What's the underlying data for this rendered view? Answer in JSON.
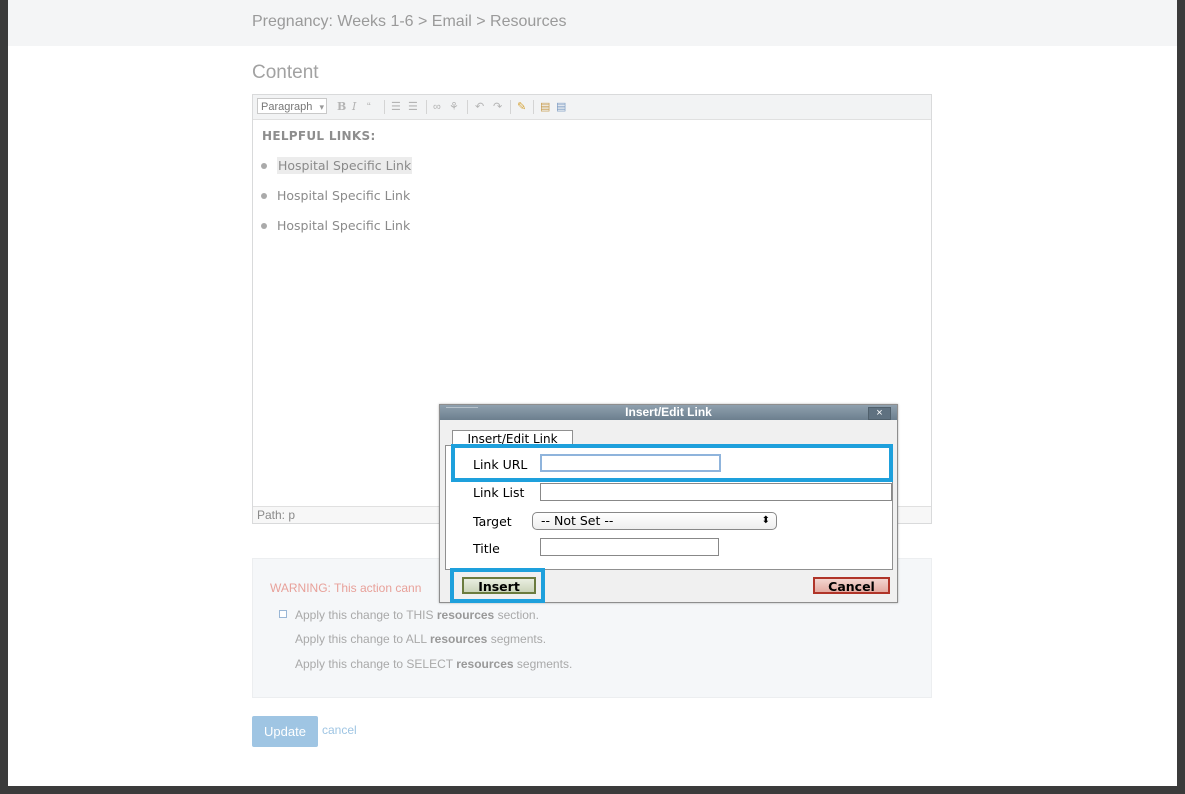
{
  "breadcrumb": "Pregnancy: Weeks 1-6 > Email > Resources",
  "content_title": "Content",
  "editor": {
    "format_select": "Paragraph",
    "toolbar_icons": [
      "bold-icon",
      "italic-icon",
      "blockquote-icon",
      "bullet-list-icon",
      "numbered-list-icon",
      "link-icon",
      "unlink-icon",
      "undo-icon",
      "redo-icon",
      "cleanup-icon",
      "paste-text-icon",
      "paste-word-icon"
    ],
    "heading": "HELPFUL LINKS:",
    "items": [
      "Hospital Specific Link",
      "Hospital Specific Link",
      "Hospital Specific Link"
    ],
    "path": "Path: p"
  },
  "apply": {
    "warning": "WARNING: This action cann",
    "options": [
      {
        "pre": "Apply this change to THIS ",
        "bold": "resources",
        "post": " section."
      },
      {
        "pre": "Apply this change to ALL ",
        "bold": "resources",
        "post": " segments."
      },
      {
        "pre": "Apply this change to SELECT ",
        "bold": "resources",
        "post": " segments."
      }
    ]
  },
  "update_label": "Update",
  "cancel_link": "cancel",
  "dialog": {
    "title": "Insert/Edit Link",
    "tab": "Insert/Edit Link",
    "link_url_label": "Link URL",
    "link_url_value": "",
    "link_list_label": "Link List",
    "target_label": "Target",
    "target_value": "-- Not Set --",
    "title_label": "Title",
    "title_value": "",
    "insert_label": "Insert",
    "cancel_label": "Cancel"
  },
  "highlight_color": "#1ea0dc"
}
